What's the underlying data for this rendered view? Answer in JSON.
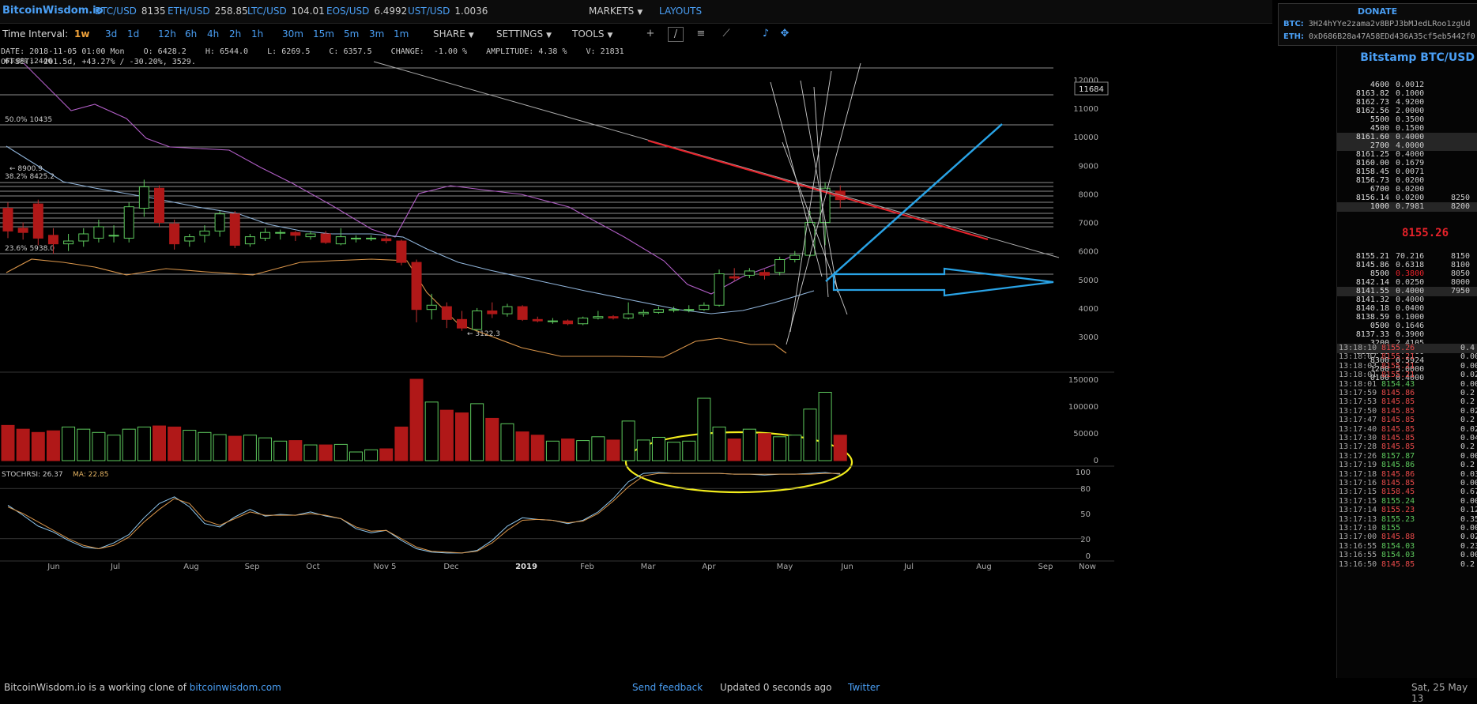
{
  "topbar": {
    "logo": "BitcoinWisdom.io",
    "tickers": [
      {
        "symbol": "BTC/USD",
        "price": "8135"
      },
      {
        "symbol": "ETH/USD",
        "price": "258.85"
      },
      {
        "symbol": "LTC/USD",
        "price": "104.01"
      },
      {
        "symbol": "EOS/USD",
        "price": "6.4992"
      },
      {
        "symbol": "UST/USD",
        "price": "1.0036"
      }
    ],
    "markets_label": "MARKETS",
    "layouts_label": "LAYOUTS"
  },
  "donate": {
    "title": "DONATE",
    "btc_label": "BTC:",
    "btc_address": "3H24hYYe2zama2v8BPJ3bMJedLRoo1zgUd",
    "eth_label": "ETH:",
    "eth_address": "0xD686B28a47A58EDd436A35cf5eb5442f0"
  },
  "toolbar": {
    "time_interval_label": "Time Interval:",
    "intervals": [
      "1w",
      "3d",
      "1d",
      "12h",
      "6h",
      "4h",
      "2h",
      "1h",
      "30m",
      "15m",
      "5m",
      "3m",
      "1m"
    ],
    "active_interval": "1w",
    "share_label": "SHARE",
    "settings_label": "SETTINGS",
    "tools_label": "TOOLS",
    "icons": [
      "crosshair-icon",
      "line-tool-icon",
      "horizontal-lines-icon",
      "fan-tool-icon",
      "bell-icon",
      "fullscreen-icon"
    ]
  },
  "info": {
    "line1": "DATE: 2018-11-05 01:00 Mon    O: 6428.2    H: 6544.0    L: 6269.5    C: 6357.5    CHANGE:  -1.00 %    AMPLITUDE: 4.38 %    V: 21831",
    "line2": "OFFSET: -201.5d, +43.27% / -30.20%, 3529."
  },
  "chart_data": {
    "type": "candlestick",
    "price_axis_ticks": [
      "12000",
      "11000",
      "10000",
      "9000",
      "8000",
      "7000",
      "6000",
      "5000",
      "4000",
      "3000"
    ],
    "current_price_marker": "11684",
    "fib_labels": [
      "61.8% 12446",
      "50.0% 10435",
      "38.2% 8425.2",
      "23.6% 5938.0"
    ],
    "high_annotation": "← 8900.9",
    "low_annotation": "← 3122.3",
    "volume_axis_ticks": [
      "150000",
      "100000",
      "50000",
      "0"
    ],
    "stochrsi_label": "STOCHRSI: 26.37",
    "ma_label": "MA: 22.85",
    "stochrsi_axis_ticks": [
      "100",
      "80",
      "50",
      "20",
      "0"
    ],
    "x_axis_labels": [
      "Jun",
      "Jul",
      "Aug",
      "Sep",
      "Oct",
      "Nov 5",
      "Dec",
      "2019",
      "Feb",
      "Mar",
      "Apr",
      "May",
      "Jun",
      "Jul",
      "Aug",
      "Sep",
      "Now"
    ],
    "candles": [
      {
        "o": 7500,
        "c": 6700,
        "h": 7700,
        "l": 6450
      },
      {
        "o": 6800,
        "c": 6650,
        "h": 7000,
        "l": 6400
      },
      {
        "o": 7650,
        "c": 6450,
        "h": 7800,
        "l": 6200
      },
      {
        "o": 6550,
        "c": 6250,
        "h": 6800,
        "l": 5900
      },
      {
        "o": 6250,
        "c": 6350,
        "h": 6600,
        "l": 6000
      },
      {
        "o": 6350,
        "c": 6600,
        "h": 6800,
        "l": 6150
      },
      {
        "o": 6450,
        "c": 6850,
        "h": 7100,
        "l": 6300
      },
      {
        "o": 6550,
        "c": 6550,
        "h": 6900,
        "l": 6300
      },
      {
        "o": 6450,
        "c": 7550,
        "h": 7700,
        "l": 6300
      },
      {
        "o": 7500,
        "c": 8250,
        "h": 8500,
        "l": 7200
      },
      {
        "o": 8200,
        "c": 7000,
        "h": 8300,
        "l": 6850
      },
      {
        "o": 6950,
        "c": 6250,
        "h": 7100,
        "l": 6050
      },
      {
        "o": 6350,
        "c": 6500,
        "h": 6600,
        "l": 6150
      },
      {
        "o": 6550,
        "c": 6700,
        "h": 6900,
        "l": 6300
      },
      {
        "o": 6700,
        "c": 7300,
        "h": 7400,
        "l": 6500
      },
      {
        "o": 7300,
        "c": 6200,
        "h": 7400,
        "l": 6100
      },
      {
        "o": 6250,
        "c": 6500,
        "h": 6600,
        "l": 6150
      },
      {
        "o": 6450,
        "c": 6650,
        "h": 6800,
        "l": 6350
      },
      {
        "o": 6650,
        "c": 6650,
        "h": 6750,
        "l": 6400
      },
      {
        "o": 6650,
        "c": 6550,
        "h": 6700,
        "l": 6350
      },
      {
        "o": 6500,
        "c": 6600,
        "h": 6700,
        "l": 6400
      },
      {
        "o": 6600,
        "c": 6300,
        "h": 6700,
        "l": 6250
      },
      {
        "o": 6250,
        "c": 6500,
        "h": 6800,
        "l": 6200
      },
      {
        "o": 6450,
        "c": 6450,
        "h": 6550,
        "l": 6300
      },
      {
        "o": 6450,
        "c": 6450,
        "h": 6550,
        "l": 6350
      },
      {
        "o": 6430,
        "c": 6360,
        "h": 6550,
        "l": 6270
      },
      {
        "o": 6350,
        "c": 5600,
        "h": 6400,
        "l": 5500
      },
      {
        "o": 5600,
        "c": 3950,
        "h": 5700,
        "l": 3500
      },
      {
        "o": 3950,
        "c": 4100,
        "h": 4500,
        "l": 3600
      },
      {
        "o": 4050,
        "c": 3600,
        "h": 4200,
        "l": 3300
      },
      {
        "o": 3600,
        "c": 3300,
        "h": 3900,
        "l": 3200
      },
      {
        "o": 3250,
        "c": 3900,
        "h": 4000,
        "l": 3200
      },
      {
        "o": 3900,
        "c": 3800,
        "h": 4200,
        "l": 3650
      },
      {
        "o": 3800,
        "c": 4050,
        "h": 4150,
        "l": 3700
      },
      {
        "o": 4050,
        "c": 3600,
        "h": 4100,
        "l": 3550
      },
      {
        "o": 3600,
        "c": 3550,
        "h": 3700,
        "l": 3500
      },
      {
        "o": 3550,
        "c": 3550,
        "h": 3650,
        "l": 3450
      },
      {
        "o": 3550,
        "c": 3450,
        "h": 3600,
        "l": 3400
      },
      {
        "o": 3450,
        "c": 3650,
        "h": 3700,
        "l": 3400
      },
      {
        "o": 3650,
        "c": 3700,
        "h": 3900,
        "l": 3600
      },
      {
        "o": 3700,
        "c": 3650,
        "h": 3750,
        "l": 3600
      },
      {
        "o": 3650,
        "c": 3800,
        "h": 4200,
        "l": 3600
      },
      {
        "o": 3800,
        "c": 3850,
        "h": 3950,
        "l": 3700
      },
      {
        "o": 3850,
        "c": 3950,
        "h": 4050,
        "l": 3800
      },
      {
        "o": 3950,
        "c": 3950,
        "h": 4050,
        "l": 3850
      },
      {
        "o": 3950,
        "c": 3950,
        "h": 4100,
        "l": 3850
      },
      {
        "o": 3950,
        "c": 4100,
        "h": 4200,
        "l": 3900
      },
      {
        "o": 4100,
        "c": 5200,
        "h": 5350,
        "l": 4050
      },
      {
        "o": 5100,
        "c": 5050,
        "h": 5400,
        "l": 4950
      },
      {
        "o": 5150,
        "c": 5300,
        "h": 5400,
        "l": 5050
      },
      {
        "o": 5250,
        "c": 5150,
        "h": 5350,
        "l": 5000
      },
      {
        "o": 5250,
        "c": 5700,
        "h": 5800,
        "l": 5150
      },
      {
        "o": 5700,
        "c": 5850,
        "h": 6000,
        "l": 5600
      },
      {
        "o": 5850,
        "c": 7000,
        "h": 7400,
        "l": 5800
      },
      {
        "o": 7000,
        "c": 8200,
        "h": 8400,
        "l": 6200
      },
      {
        "o": 8100,
        "c": 7800,
        "h": 8300,
        "l": 7500
      }
    ],
    "volumes": [
      65000,
      58000,
      52000,
      55000,
      62000,
      58000,
      52000,
      47000,
      58000,
      62000,
      64000,
      62000,
      56000,
      52000,
      48000,
      45000,
      47000,
      42000,
      36000,
      37000,
      29000,
      29000,
      30000,
      16000,
      20000,
      21831,
      62000,
      150000,
      108000,
      93000,
      88000,
      105000,
      78000,
      68000,
      53000,
      47000,
      36000,
      40000,
      37000,
      44000,
      38000,
      73000,
      38000,
      43000,
      34000,
      36000,
      115000,
      62000,
      40000,
      58000,
      50000,
      44000,
      47000,
      95000,
      126000,
      47000
    ],
    "stochrsi": [
      60,
      48,
      35,
      28,
      18,
      10,
      8,
      15,
      25,
      45,
      62,
      70,
      58,
      38,
      34,
      46,
      55,
      47,
      49,
      48,
      52,
      47,
      44,
      32,
      27,
      30,
      18,
      8,
      4,
      3,
      3,
      6,
      18,
      35,
      45,
      43,
      42,
      38,
      42,
      52,
      68,
      88,
      98,
      99,
      98,
      98,
      98,
      98,
      97,
      97,
      96,
      97,
      97,
      98,
      99,
      97
    ],
    "stoch_ma": [
      58,
      50,
      40,
      30,
      20,
      12,
      8,
      12,
      22,
      40,
      55,
      68,
      62,
      42,
      36,
      44,
      52,
      48,
      48,
      48,
      50,
      48,
      44,
      34,
      29,
      30,
      20,
      10,
      5,
      4,
      3,
      5,
      15,
      30,
      42,
      43,
      42,
      39,
      41,
      50,
      65,
      82,
      95,
      98,
      98,
      98,
      98,
      98,
      97,
      97,
      97,
      97,
      97,
      97,
      98,
      98
    ]
  },
  "sidebar": {
    "title": "Bitstamp BTC/USD",
    "asks": [
      {
        "price": "4600",
        "amount": "0.0012",
        "side": ""
      },
      {
        "price": "8163.82",
        "amount": "0.1000",
        "side": ""
      },
      {
        "price": "8162.73",
        "amount": "4.9200",
        "side": ""
      },
      {
        "price": "8162.56",
        "amount": "2.0000",
        "side": ""
      },
      {
        "price": "5500",
        "amount": "0.3500",
        "side": ""
      },
      {
        "price": "4500",
        "amount": "0.1500",
        "side": ""
      },
      {
        "price": "8161.60",
        "amount": "0.4000",
        "side": ""
      },
      {
        "price": "2700",
        "amount": "4.0000",
        "side": ""
      },
      {
        "price": "8161.25",
        "amount": "0.4000",
        "side": ""
      },
      {
        "price": "8160.00",
        "amount": "0.1679",
        "side": ""
      },
      {
        "price": "8158.45",
        "amount": "0.0071",
        "side": ""
      },
      {
        "price": "8156.73",
        "amount": "0.0200",
        "side": ""
      },
      {
        "price": "6700",
        "amount": "0.0200",
        "side": ""
      },
      {
        "price": "8156.14",
        "amount": "0.0200",
        "side": "8250"
      },
      {
        "price": "1000",
        "amount": "0.7981",
        "side": "8200"
      }
    ],
    "mid_price": "8155.26",
    "bids": [
      {
        "price": "8155.21",
        "amount": "70.216",
        "side": "8150"
      },
      {
        "price": "8145.86",
        "amount": "0.6318",
        "side": "8100"
      },
      {
        "price": "8500",
        "amount": "0.3800",
        "side": "8050"
      },
      {
        "price": "8142.14",
        "amount": "0.0250",
        "side": "8000"
      },
      {
        "price": "8141.55",
        "amount": "0.4000",
        "side": "7950"
      },
      {
        "price": "8141.32",
        "amount": "0.4000",
        "side": ""
      },
      {
        "price": "8140.18",
        "amount": "0.0400",
        "side": ""
      },
      {
        "price": "8138.59",
        "amount": "0.1000",
        "side": ""
      },
      {
        "price": "0500",
        "amount": "0.1646",
        "side": ""
      },
      {
        "price": "8137.33",
        "amount": "0.3900",
        "side": ""
      },
      {
        "price": "3200",
        "amount": "2.4105",
        "side": ""
      },
      {
        "price": "8135.88",
        "amount": "0.4000",
        "side": ""
      },
      {
        "price": "8300",
        "amount": "0.5924",
        "side": ""
      },
      {
        "price": "1200",
        "amount": "5.0000",
        "side": ""
      },
      {
        "price": "0100",
        "amount": "0.4000",
        "side": ""
      }
    ],
    "trades": [
      {
        "time": "13:18:10",
        "price": "8155.26",
        "amount": "0.4",
        "dir": "down"
      },
      {
        "time": "13:18:07",
        "price": "8155.21",
        "amount": "0.00",
        "dir": "down"
      },
      {
        "time": "13:18:03",
        "price": "8155.21",
        "amount": "0.00",
        "dir": "down"
      },
      {
        "time": "13:18:01",
        "price": "8155.21",
        "amount": "0.02",
        "dir": "down"
      },
      {
        "time": "13:18:01",
        "price": "8154.43",
        "amount": "0.00",
        "dir": "up"
      },
      {
        "time": "13:17:59",
        "price": "8145.86",
        "amount": "0.2",
        "dir": "down"
      },
      {
        "time": "13:17:53",
        "price": "8145.85",
        "amount": "0.2",
        "dir": "down"
      },
      {
        "time": "13:17:50",
        "price": "8145.85",
        "amount": "0.02",
        "dir": "down"
      },
      {
        "time": "13:17:47",
        "price": "8145.85",
        "amount": "0.2",
        "dir": "down"
      },
      {
        "time": "13:17:40",
        "price": "8145.85",
        "amount": "0.02",
        "dir": "down"
      },
      {
        "time": "13:17:30",
        "price": "8145.85",
        "amount": "0.04",
        "dir": "down"
      },
      {
        "time": "13:17:28",
        "price": "8145.85",
        "amount": "0.2",
        "dir": "down"
      },
      {
        "time": "13:17:26",
        "price": "8157.87",
        "amount": "0.00",
        "dir": "up"
      },
      {
        "time": "13:17:19",
        "price": "8145.86",
        "amount": "0.2",
        "dir": "up"
      },
      {
        "time": "13:17:18",
        "price": "8145.86",
        "amount": "0.03",
        "dir": "down"
      },
      {
        "time": "13:17:16",
        "price": "8145.85",
        "amount": "0.00",
        "dir": "down"
      },
      {
        "time": "13:17:15",
        "price": "8158.45",
        "amount": "0.67",
        "dir": "down"
      },
      {
        "time": "13:17:15",
        "price": "8155.24",
        "amount": "0.00",
        "dir": "up"
      },
      {
        "time": "13:17:14",
        "price": "8155.23",
        "amount": "0.12",
        "dir": "down"
      },
      {
        "time": "13:17:13",
        "price": "8155.23",
        "amount": "0.35",
        "dir": "up"
      },
      {
        "time": "13:17:10",
        "price": "8155",
        "amount": "0.00",
        "dir": "up"
      },
      {
        "time": "13:17:00",
        "price": "8145.88",
        "amount": "0.02",
        "dir": "down"
      },
      {
        "time": "13:16:55",
        "price": "8154.03",
        "amount": "0.23",
        "dir": "up"
      },
      {
        "time": "13:16:55",
        "price": "8154.03",
        "amount": "0.00",
        "dir": "up"
      },
      {
        "time": "13:16:50",
        "price": "8145.85",
        "amount": "0.2",
        "dir": "down"
      }
    ]
  },
  "footer": {
    "clone_text": "BitcoinWisdom.io is a working clone of",
    "clone_link": "bitcoinwisdom.com",
    "feedback": "Send feedback",
    "updated": "Updated 0 seconds ago",
    "twitter": "Twitter",
    "date": "Sat, 25 May 13"
  },
  "colors": {
    "accent": "#4a9ff5",
    "up": "#5dc95d",
    "down": "#b01818",
    "active_interval": "#f0a23a",
    "trend_red": "#e8222a",
    "arrow_blue": "#29a3e6",
    "ellipse_yellow": "#f2ec1c",
    "boll_upper": "#b15ec6",
    "boll_lower": "#d9954a",
    "ma_line": "#8fb3d9"
  }
}
